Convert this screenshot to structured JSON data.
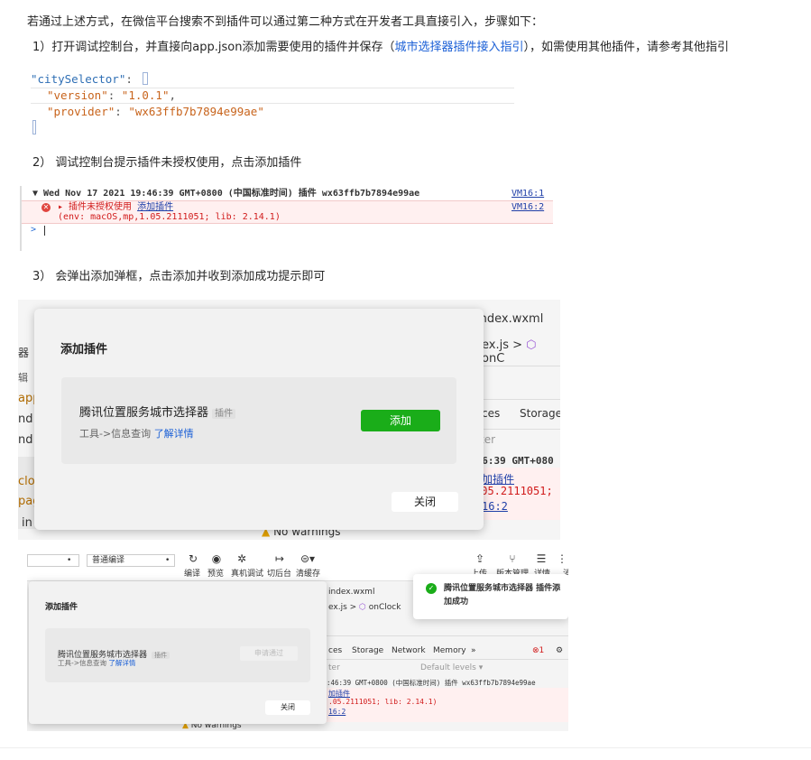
{
  "intro": "若通过上述方式，在微信平台搜索不到插件可以通过第二种方式在开发者工具直接引入，步骤如下：",
  "step1": {
    "prefix": "1）打开调试控制台，并直接向app.json添加需要使用的插件并保存（",
    "link": "城市选择器插件接入指引",
    "suffix": "），如需使用其他插件，请参考其他指引"
  },
  "code": {
    "key_city": "\"citySelector\"",
    "colon": ":",
    "key_version": "\"version\"",
    "val_version": "\"1.0.1\"",
    "key_provider": "\"provider\"",
    "val_provider": "\"wx63ffb7b7894e99ae\"",
    "comma": ","
  },
  "step2": "2） 调试控制台提示插件未授权使用，点击添加插件",
  "console": {
    "line1": "▼ Wed Nov 17 2021 19:46:39 GMT+0800 (中国标准时间) 插件 wx63ffb7b7894e99ae",
    "vm1": "VM16:1",
    "err_text": "▸ 插件未授权使用",
    "err_link": "添加插件",
    "env": "(env: macOS,mp,1.05.2111051; lib: 2.14.1)",
    "vm2": "VM16:2",
    "prompt": ">"
  },
  "step3": "3） 会弹出添加弹框，点击添加并收到添加成功提示即可",
  "shot1": {
    "bg_tab": "index.wxml",
    "bg_breadcrumb_file": "ex.js",
    "bg_breadcrumb_fn": "onC",
    "bg_storage": "Storage",
    "bg_ces": "ces",
    "bg_ter": "ter",
    "bg_time": ":46:39 GMT+080",
    "bg_link": "加插件",
    "bg_ver": ".05.2111051;",
    "bg_vm": "16:2",
    "bg_warn": "No warnings",
    "left_frags": [
      "器",
      "辑",
      "app",
      "nd",
      "nd",
      "clou",
      "pag",
      "in"
    ],
    "dialog_title": "添加插件",
    "plugin_name": "腾讯位置服务城市选择器",
    "plugin_tag": "插件",
    "plugin_category": "工具->信息查询",
    "plugin_more": "了解详情",
    "add_button": "添加",
    "close_button": "关闭"
  },
  "shot2": {
    "mode_select": "普通编译",
    "toolbar_labels": [
      "编译",
      "预览",
      "真机调试",
      "切后台",
      "清缓存"
    ],
    "right_labels": [
      "上传",
      "版本管理",
      "详情",
      "消"
    ],
    "bg_tab": "index.wxml",
    "bg_breadcrumb_file": "ex.js",
    "bg_breadcrumb_fn": "onClock",
    "bg_tabs": [
      "ces",
      "Storage",
      "Network",
      "Memory",
      "»"
    ],
    "err_count": "1",
    "default_levels": "Default levels ▾",
    "bg_ter": "ter",
    "bg_console_line": ":46:39 GMT+0800 (中国标准时间) 插件 wx63ffb7b7894e99ae",
    "bg_link": "加插件",
    "bg_ver": ".05.2111051; lib: 2.14.1)",
    "bg_vm": "16:2",
    "bg_warn": "No warnings",
    "dialog_title": "添加插件",
    "plugin_name": "腾讯位置服务城市选择器",
    "plugin_tag": "插件",
    "plugin_category": "工具->信息查询",
    "plugin_more": "了解详情",
    "applied_button": "申请通过",
    "close_button": "关闭",
    "toast_line1": "腾讯位置服务城市选择器 插件添",
    "toast_line2": "加成功"
  },
  "colors": {
    "green": "#1aad19",
    "link": "#1a5fd6",
    "error_red": "#d11b1b"
  }
}
